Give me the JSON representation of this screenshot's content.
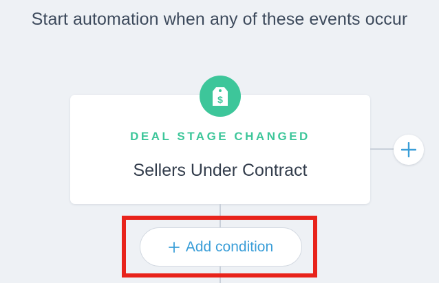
{
  "heading": "Start automation when any of these events occur",
  "trigger": {
    "icon": "price-tag-dollar-icon",
    "type_label": "DEAL STAGE CHANGED",
    "value": "Sellers Under Contract"
  },
  "add_branch": {
    "icon": "plus-icon"
  },
  "add_condition": {
    "icon": "plus-icon",
    "label": "Add condition"
  },
  "colors": {
    "accent_green": "#3dc69a",
    "link_blue": "#3a9ed8",
    "highlight_red": "#e8231b",
    "background": "#eef1f5"
  }
}
